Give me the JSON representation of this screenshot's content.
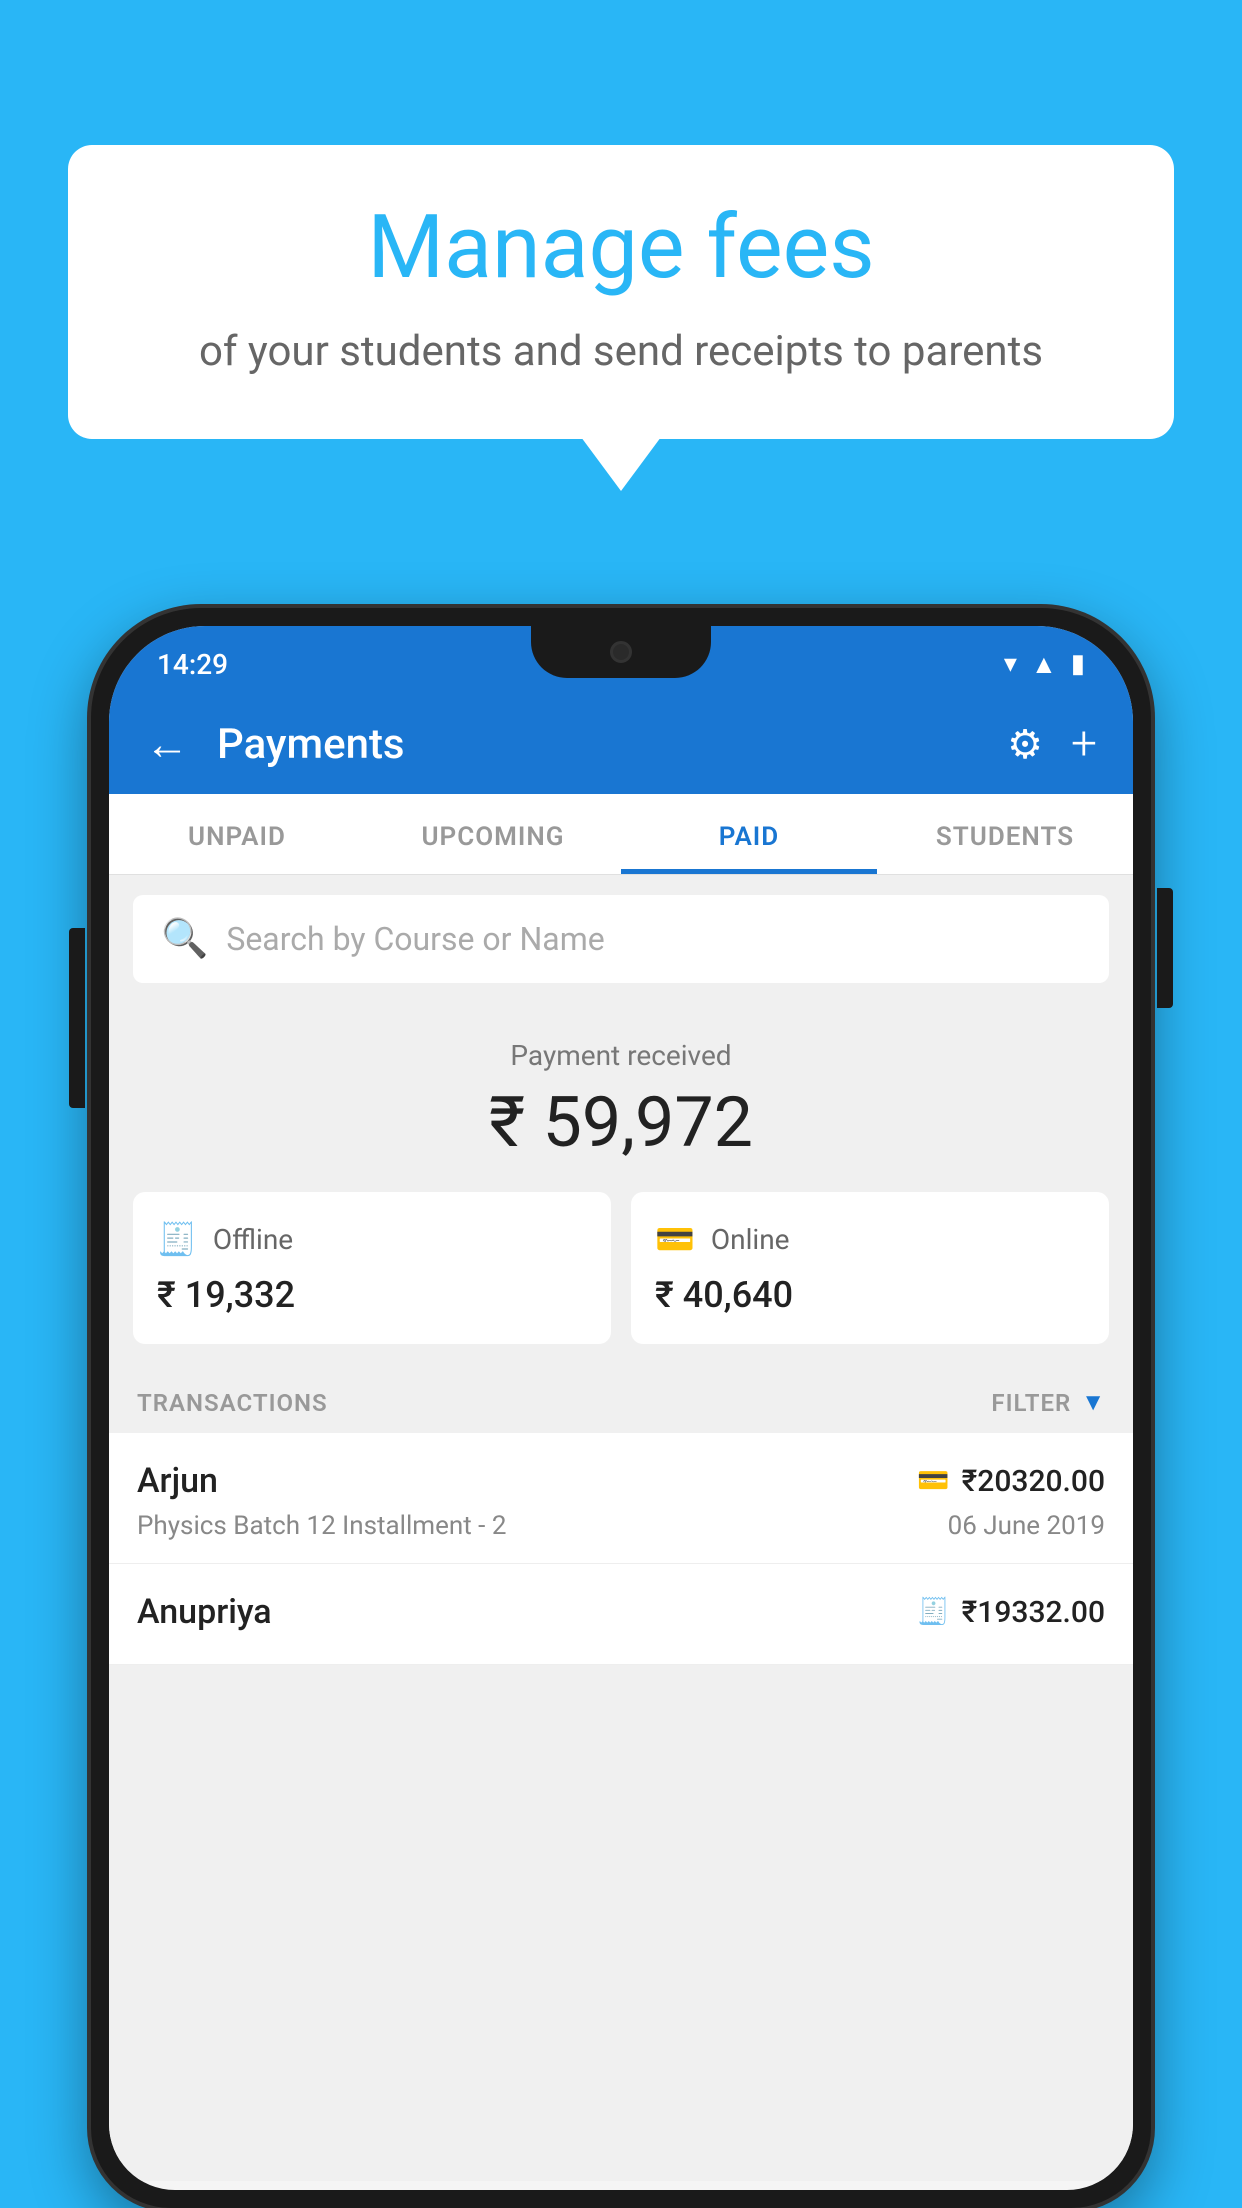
{
  "background_color": "#29b6f6",
  "bubble": {
    "title": "Manage fees",
    "subtitle": "of your students and send receipts to parents"
  },
  "status_bar": {
    "time": "14:29"
  },
  "header": {
    "title": "Payments",
    "back_label": "←",
    "gear_label": "⚙",
    "plus_label": "+"
  },
  "tabs": [
    {
      "label": "UNPAID",
      "active": false
    },
    {
      "label": "UPCOMING",
      "active": false
    },
    {
      "label": "PAID",
      "active": true
    },
    {
      "label": "STUDENTS",
      "active": false
    }
  ],
  "search": {
    "placeholder": "Search by Course or Name"
  },
  "payment_section": {
    "label": "Payment received",
    "amount": "₹ 59,972"
  },
  "cards": [
    {
      "type": "Offline",
      "amount": "₹ 19,332",
      "icon": "💳"
    },
    {
      "type": "Online",
      "amount": "₹ 40,640",
      "icon": "💳"
    }
  ],
  "transactions_label": "TRANSACTIONS",
  "filter_label": "FILTER",
  "transactions": [
    {
      "name": "Arjun",
      "course": "Physics Batch 12 Installment - 2",
      "amount": "₹20320.00",
      "date": "06 June 2019",
      "pay_type": "online"
    },
    {
      "name": "Anupriya",
      "course": "",
      "amount": "₹19332.00",
      "date": "",
      "pay_type": "offline"
    }
  ]
}
